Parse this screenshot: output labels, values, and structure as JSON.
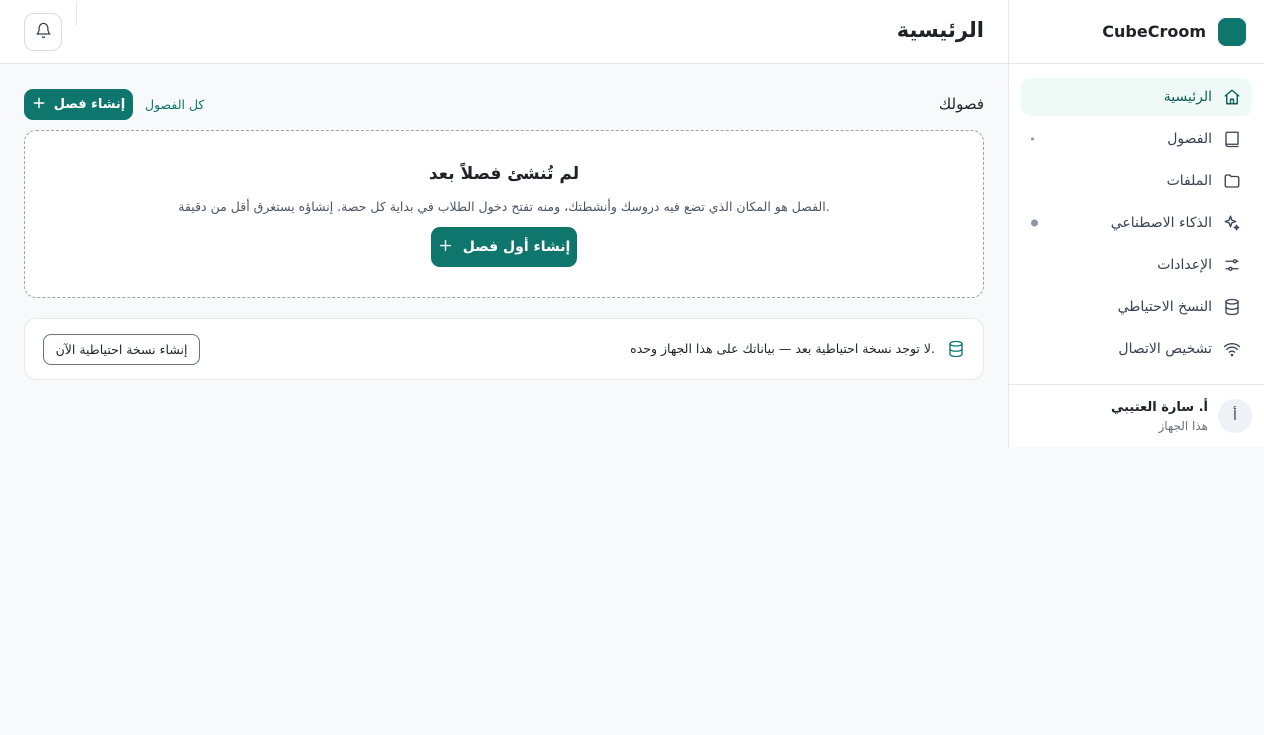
{
  "app": {
    "brand_name": "CubeCroom",
    "accent_color": "#0f766e"
  },
  "header": {
    "title": "الرئيسية",
    "bell_icon": "bell-icon"
  },
  "sidebar": {
    "items": [
      {
        "label": "الرئيسية",
        "icon": "home-icon",
        "active": true
      },
      {
        "label": "الفصول",
        "icon": "book-icon"
      },
      {
        "label": "الملفات",
        "icon": "folder-icon"
      },
      {
        "label": "الذكاء الاصطناعي",
        "icon": "sparkles-icon"
      },
      {
        "label": "الإعدادات",
        "icon": "sliders-icon"
      },
      {
        "label": "النسخ الاحتياطي",
        "icon": "database-icon"
      },
      {
        "label": "تشخيص الاتصال",
        "icon": "wifi-icon"
      }
    ],
    "user": {
      "name": "أ. سارة العتيبي",
      "subtitle": "هذا الجهاز",
      "avatar_letter": "أ"
    }
  },
  "classes": {
    "title": "فصولك",
    "all_link": "كل الفصول",
    "create_button": "إنشاء فصل",
    "empty": {
      "title": "لم تُنشئ فصلاً بعد",
      "description": "الفصل هو المكان الذي تضع فيه دروسك وأنشطتك، ومنه تفتح دخول الطلاب في بداية كل حصة. إنشاؤه يستغرق أقل من دقيقة.",
      "button": "إنشاء أول فصل"
    }
  },
  "backup": {
    "message": "لا توجد نسخة احتياطية بعد — بياناتك على هذا الجهاز وحده.",
    "button": "إنشاء نسخة احتياطية الآن"
  }
}
